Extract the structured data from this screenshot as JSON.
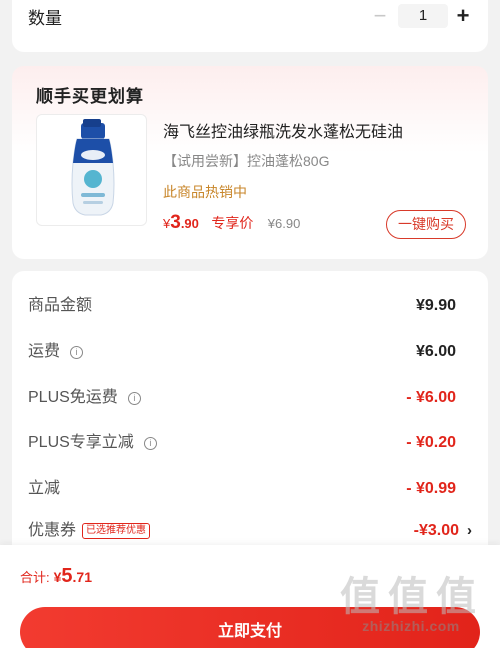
{
  "quantity": {
    "label": "数量",
    "minus": "−",
    "value": "1",
    "plus": "+"
  },
  "addon": {
    "title": "顺手买更划算",
    "product": {
      "name": "海飞丝控油绿瓶洗发水蓬松无硅油",
      "spec": "【试用尝新】控油蓬松80G",
      "hot": "此商品热销中",
      "price_currency": "¥",
      "price_int": "3",
      "price_dec": ".90",
      "price_tag": "专享价",
      "orig_price": "¥6.90",
      "buy_label": "一键购买"
    }
  },
  "summary": {
    "rows": [
      {
        "label": "商品金额",
        "value": "¥9.90"
      },
      {
        "label": "运费",
        "value": "¥6.00"
      },
      {
        "label": "PLUS免运费",
        "value": "- ¥6.00"
      },
      {
        "label": "PLUS专享立减",
        "value": "- ¥0.20"
      },
      {
        "label": "立减",
        "value": "- ¥0.99"
      },
      {
        "label": "优惠券",
        "badge": "已选推荐优惠",
        "value": "-¥3.00"
      }
    ]
  },
  "footer": {
    "total_label": "合计:",
    "total_currency": "¥",
    "total_int": "5",
    "total_dec": ".71",
    "pay_label": "立即支付"
  },
  "watermark": {
    "text": "zhizhizhi.com",
    "glyph": "值"
  },
  "colors": {
    "accent": "#e1251b",
    "hot": "#c8862a",
    "muted": "#888888"
  },
  "icons": [
    "info-icon",
    "chevron-right-icon"
  ]
}
